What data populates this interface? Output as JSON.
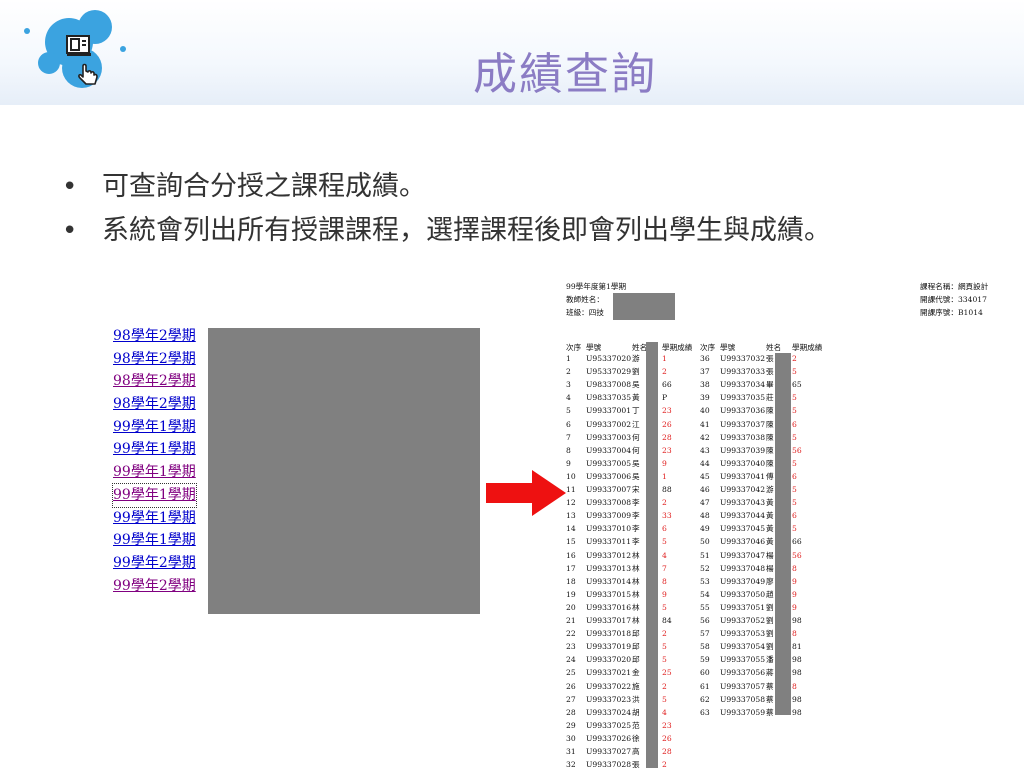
{
  "slide": {
    "title": "成績查詢",
    "bullets": [
      "可查詢合分授之課程成績。",
      "系統會列出所有授課課程，選擇課程後即會列出學生與成績。"
    ]
  },
  "course_links": [
    {
      "text": "98學年2學期",
      "visited": false
    },
    {
      "text": "98學年2學期",
      "visited": false
    },
    {
      "text": "98學年2學期",
      "visited": true
    },
    {
      "text": "98學年2學期",
      "visited": false
    },
    {
      "text": "99學年1學期",
      "visited": false
    },
    {
      "text": "99學年1學期",
      "visited": false
    },
    {
      "text": "99學年1學期",
      "visited": true
    },
    {
      "text": "99學年1學期",
      "visited": true,
      "focused": true
    },
    {
      "text": "99學年1學期",
      "visited": false
    },
    {
      "text": "99學年1學期",
      "visited": false
    },
    {
      "text": "99學年2學期",
      "visited": false
    },
    {
      "text": "99學年2學期",
      "visited": true
    }
  ],
  "report": {
    "term": "99學年度第1學期",
    "teacher_label": "教師姓名：",
    "class_label": "班級：四技",
    "course_name": "課程名稱：網頁設計",
    "course_code": "開課代號：334017",
    "course_seq": "開課序號：B1014",
    "headers": {
      "seq": "次序",
      "id": "學號",
      "name": "姓名",
      "score": "學期成績"
    },
    "left": [
      [
        "1",
        "U95337020",
        "游",
        "1",
        1
      ],
      [
        "2",
        "U95337029",
        "劉",
        "2",
        1
      ],
      [
        "3",
        "U98337008",
        "吳",
        "66",
        0
      ],
      [
        "4",
        "U98337035",
        "黃",
        "P",
        0
      ],
      [
        "5",
        "U99337001",
        "丁",
        "23",
        1
      ],
      [
        "6",
        "U99337002",
        "江",
        "26",
        1
      ],
      [
        "7",
        "U99337003",
        "何",
        "28",
        1
      ],
      [
        "8",
        "U99337004",
        "何",
        "23",
        1
      ],
      [
        "9",
        "U99337005",
        "吳",
        "9",
        1
      ],
      [
        "10",
        "U99337006",
        "吳",
        "1",
        1
      ],
      [
        "11",
        "U99337007",
        "宋",
        "88",
        0
      ],
      [
        "12",
        "U99337008",
        "李",
        "2",
        1
      ],
      [
        "13",
        "U99337009",
        "李",
        "33",
        1
      ],
      [
        "14",
        "U99337010",
        "李",
        "6",
        1
      ],
      [
        "15",
        "U99337011",
        "李",
        "5",
        1
      ],
      [
        "16",
        "U99337012",
        "林",
        "4",
        1
      ],
      [
        "17",
        "U99337013",
        "林",
        "7",
        1
      ],
      [
        "18",
        "U99337014",
        "林",
        "8",
        1
      ],
      [
        "19",
        "U99337015",
        "林",
        "9",
        1
      ],
      [
        "20",
        "U99337016",
        "林",
        "5",
        1
      ],
      [
        "21",
        "U99337017",
        "林",
        "84",
        0
      ],
      [
        "22",
        "U99337018",
        "邱",
        "2",
        1
      ],
      [
        "23",
        "U99337019",
        "邱",
        "5",
        1
      ],
      [
        "24",
        "U99337020",
        "邱",
        "5",
        1
      ],
      [
        "25",
        "U99337021",
        "金",
        "25",
        1
      ],
      [
        "26",
        "U99337022",
        "施",
        "2",
        1
      ],
      [
        "27",
        "U99337023",
        "洪",
        "5",
        1
      ],
      [
        "28",
        "U99337024",
        "胡",
        "4",
        1
      ],
      [
        "29",
        "U99337025",
        "范",
        "23",
        1
      ],
      [
        "30",
        "U99337026",
        "徐",
        "26",
        1
      ],
      [
        "31",
        "U99337027",
        "高",
        "28",
        1
      ],
      [
        "32",
        "U99337028",
        "張",
        "2",
        1
      ]
    ],
    "right": [
      [
        "36",
        "U99337032",
        "張",
        "2",
        1
      ],
      [
        "37",
        "U99337033",
        "張",
        "5",
        1
      ],
      [
        "38",
        "U99337034",
        "畢",
        "65",
        0
      ],
      [
        "39",
        "U99337035",
        "莊",
        "5",
        1
      ],
      [
        "40",
        "U99337036",
        "陳",
        "5",
        1
      ],
      [
        "41",
        "U99337037",
        "陳",
        "6",
        1
      ],
      [
        "42",
        "U99337038",
        "陳",
        "5",
        1
      ],
      [
        "43",
        "U99337039",
        "陳",
        "56",
        1
      ],
      [
        "44",
        "U99337040",
        "陳",
        "5",
        1
      ],
      [
        "45",
        "U99337041",
        "傅",
        "6",
        1
      ],
      [
        "46",
        "U99337042",
        "游",
        "5",
        1
      ],
      [
        "47",
        "U99337043",
        "黃",
        "5",
        1
      ],
      [
        "48",
        "U99337044",
        "黃",
        "6",
        1
      ],
      [
        "49",
        "U99337045",
        "黃",
        "5",
        1
      ],
      [
        "50",
        "U99337046",
        "黃",
        "66",
        0
      ],
      [
        "51",
        "U99337047",
        "楊",
        "56",
        1
      ],
      [
        "52",
        "U99337048",
        "楊",
        "8",
        1
      ],
      [
        "53",
        "U99337049",
        "廖",
        "9",
        1
      ],
      [
        "54",
        "U99337050",
        "趙",
        "9",
        1
      ],
      [
        "55",
        "U99337051",
        "劉",
        "9",
        1
      ],
      [
        "56",
        "U99337052",
        "劉",
        "98",
        0
      ],
      [
        "57",
        "U99337053",
        "劉",
        "8",
        1
      ],
      [
        "58",
        "U99337054",
        "劉",
        "81",
        0
      ],
      [
        "59",
        "U99337055",
        "潘",
        "98",
        0
      ],
      [
        "60",
        "U99337056",
        "蔣",
        "98",
        0
      ],
      [
        "61",
        "U99337057",
        "蔡",
        "8",
        1
      ],
      [
        "62",
        "U99337058",
        "蔡",
        "98",
        0
      ],
      [
        "63",
        "U99337059",
        "蔡",
        "98",
        0
      ]
    ]
  },
  "colors": {
    "title": "#8b7cc4",
    "link": "#0000cc",
    "visited": "#800080",
    "fail": "#e02020",
    "mask": "#808080",
    "arrow": "#ee1111"
  }
}
